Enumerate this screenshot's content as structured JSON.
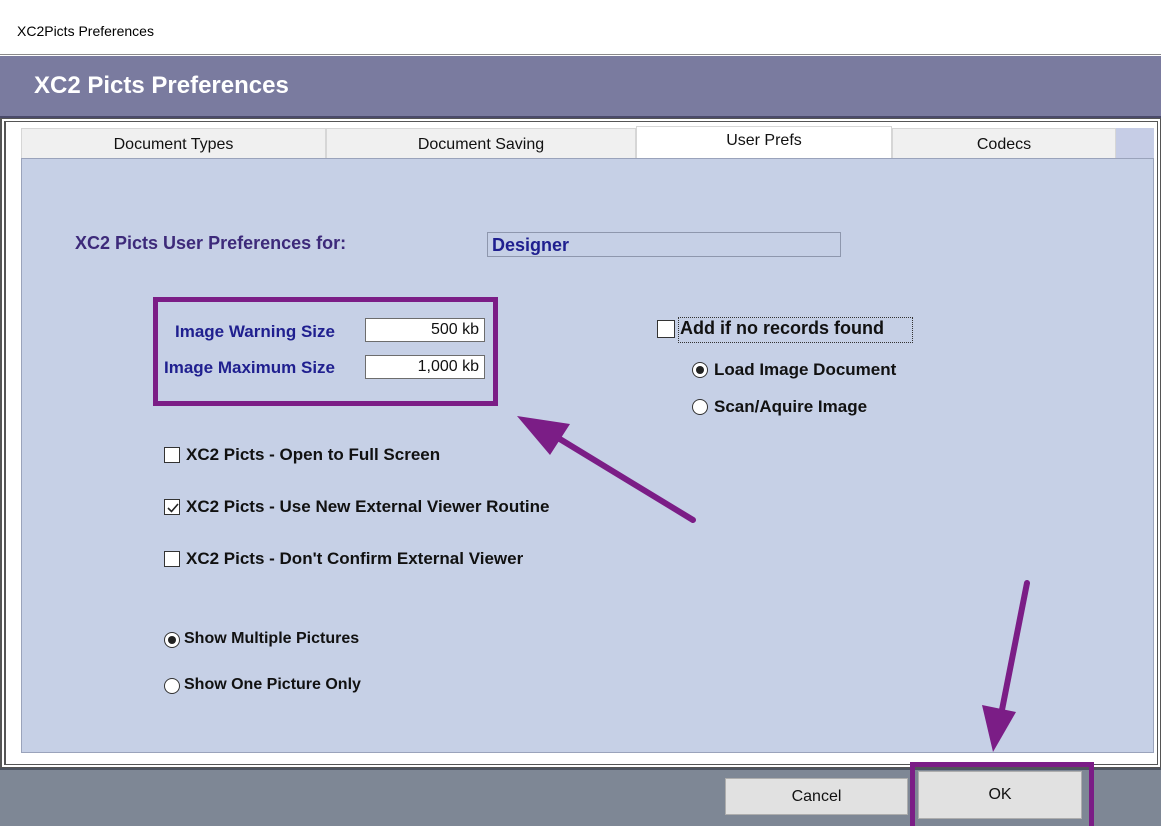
{
  "window_title": "XC2Picts Preferences",
  "header_title": "XC2 Picts Preferences",
  "tabs": [
    {
      "label": "Document Types"
    },
    {
      "label": "Document Saving"
    },
    {
      "label": "User Prefs"
    },
    {
      "label": "Codecs"
    }
  ],
  "active_tab": "User Prefs",
  "prefs_for": {
    "label": "XC2 Picts User Preferences for:",
    "value": "Designer"
  },
  "image_warning": {
    "label": "Image Warning Size",
    "value": "500 kb"
  },
  "image_maximum": {
    "label": "Image Maximum Size",
    "value": "1,000 kb"
  },
  "checkboxes": [
    {
      "label": "XC2 Picts - Open to Full Screen",
      "checked": false
    },
    {
      "label": "XC2 Picts - Use New External Viewer Routine",
      "checked": true
    },
    {
      "label": "XC2 Picts - Don't Confirm External Viewer",
      "checked": false
    }
  ],
  "picture_mode": [
    {
      "label": "Show Multiple Pictures",
      "selected": true
    },
    {
      "label": "Show One Picture Only",
      "selected": false
    }
  ],
  "add_if_none": {
    "label": "Add if no records found",
    "checked": false
  },
  "add_mode": [
    {
      "label": "Load Image Document",
      "selected": true
    },
    {
      "label": "Scan/Aquire Image",
      "selected": false
    }
  ],
  "buttons": {
    "cancel": "Cancel",
    "ok": "OK"
  },
  "colors": {
    "header": "#7a7b9f",
    "panel": "#c6d0e6",
    "highlight": "#7b1d86",
    "label": "#1f1f8f"
  },
  "icons": {
    "annotation_arrows": "arrow-icon"
  }
}
